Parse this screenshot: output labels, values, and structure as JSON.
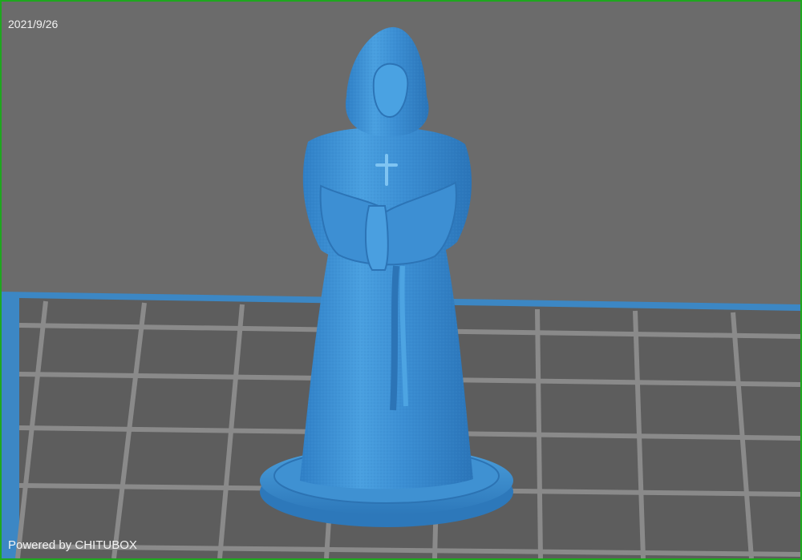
{
  "app": {
    "name": "CHITUBOX"
  },
  "overlay": {
    "date": "2021/9/26",
    "powered_by": "Powered by CHITUBOX"
  },
  "scene": {
    "model_name": "hooded-monk-figure",
    "model_color": "#3f8fd0",
    "plate_color": "#3f86c2",
    "background_color": "#6b6b6b",
    "grid_cell_color": "#5f5f5f",
    "grid_line_color": "#8c8c8c",
    "border_color": "#1fa71f"
  }
}
